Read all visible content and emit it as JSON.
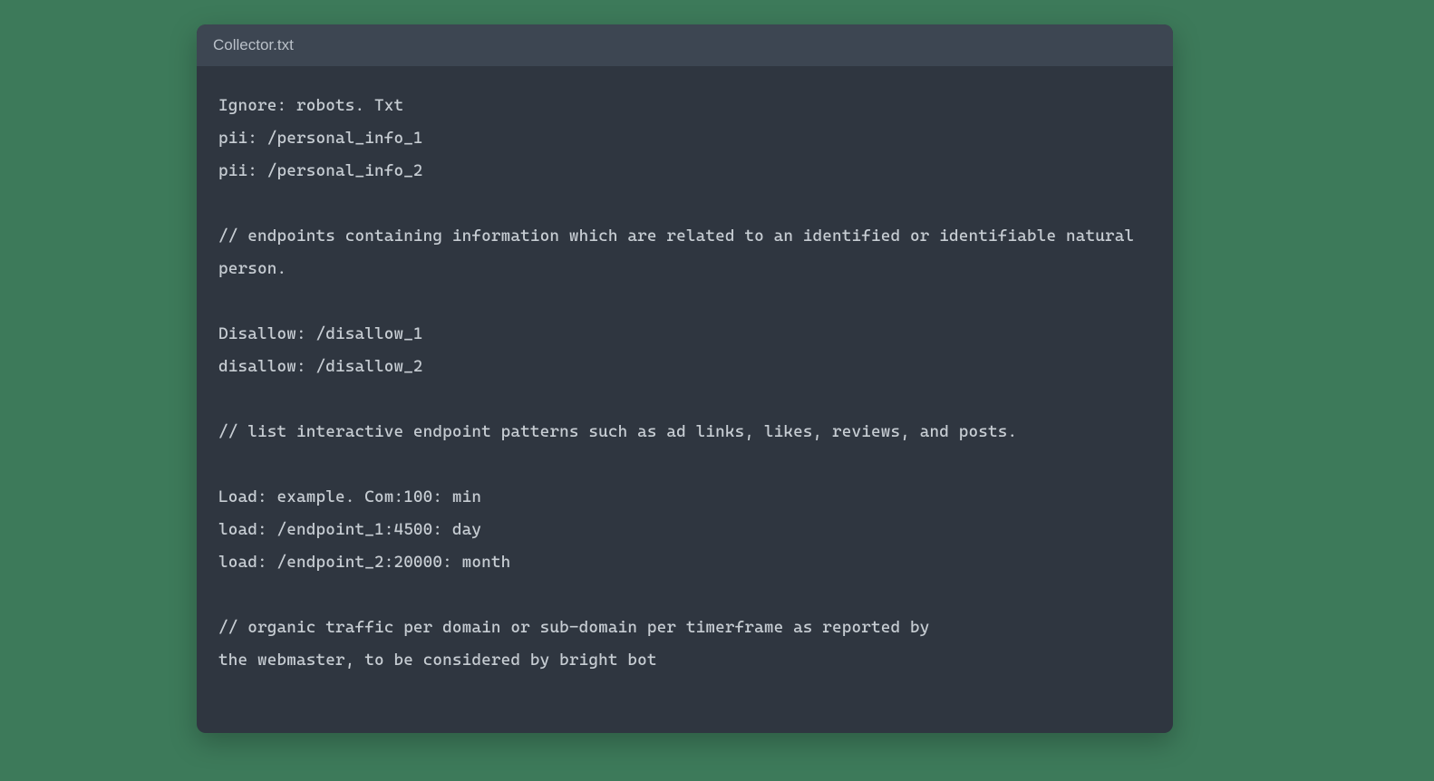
{
  "window": {
    "title": "Collector.txt"
  },
  "code": {
    "lines": [
      "Ignore: robots. Txt",
      "pii: /personal_info_1",
      "pii: /personal_info_2",
      "",
      "// endpoints containing information which are related to an identified or identifiable natural person.",
      "",
      "Disallow: /disallow_1",
      "disallow: /disallow_2",
      "",
      "// list interactive endpoint patterns such as ad links, likes, reviews, and posts.",
      "",
      "Load: example. Com:100: min",
      "load: /endpoint_1:4500: day",
      "load: /endpoint_2:20000: month",
      "",
      "// organic traffic per domain or sub-domain per timerframe as reported by",
      "the webmaster, to be considered by bright bot"
    ]
  }
}
